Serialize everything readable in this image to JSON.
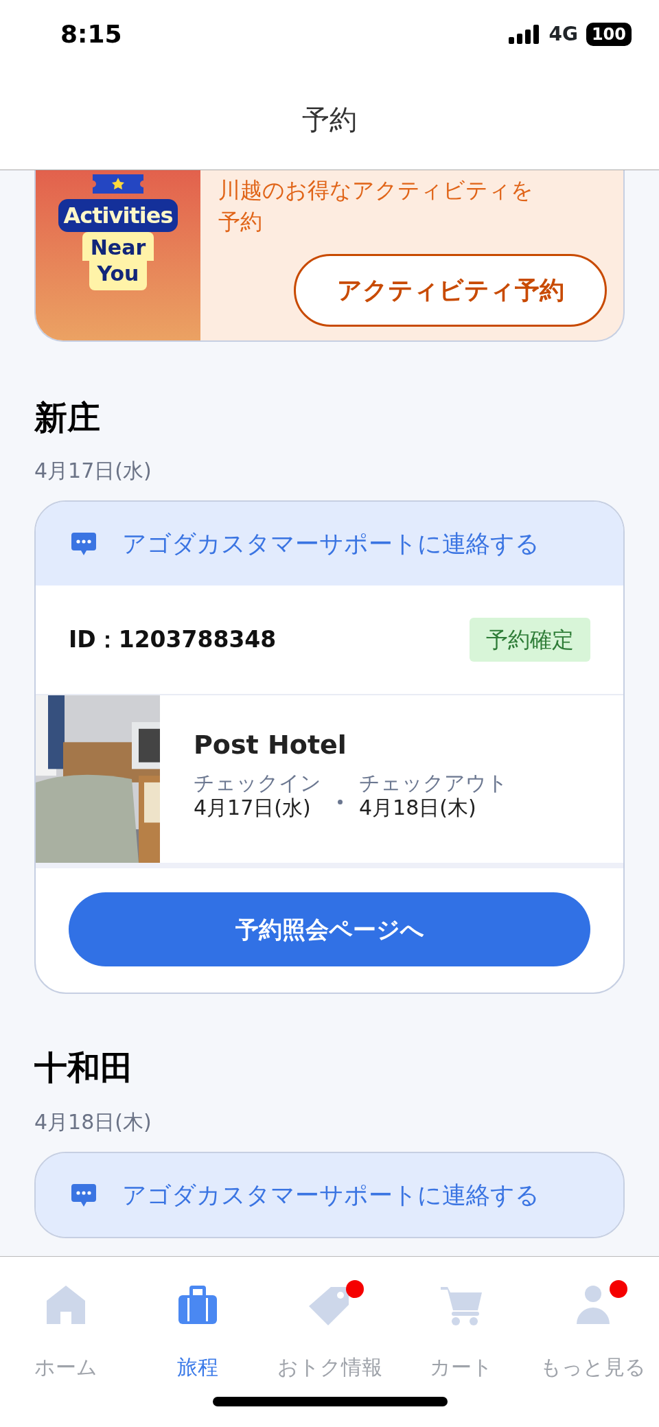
{
  "status_bar": {
    "time": "8:15",
    "network": "4G",
    "battery": "100"
  },
  "header": {
    "title": "予約"
  },
  "activity_banner": {
    "badge_lines": [
      "Activities",
      "Near",
      "You"
    ],
    "text": "川越のお得なアクティビティを予約",
    "button": "アクティビティ予約"
  },
  "trips": [
    {
      "city": "新庄",
      "date": "4月17日(水)",
      "support_link": "アゴダカスタマーサポートに連絡する",
      "booking_id": "ID：1203788348",
      "status": "予約確定",
      "hotel": {
        "name": "Post Hotel",
        "checkin_label": "チェックイン",
        "checkin": "4月17日(水)",
        "checkout_label": "チェックアウト",
        "checkout": "4月18日(木)"
      },
      "button": "予約照会ページへ"
    },
    {
      "city": "十和田",
      "date": "4月18日(木)",
      "support_link": "アゴダカスタマーサポートに連絡する"
    }
  ],
  "tab_bar": [
    {
      "label": "ホーム",
      "kind": "home",
      "selected": false,
      "badge": false
    },
    {
      "label": "旅程",
      "kind": "trips",
      "selected": true,
      "badge": false
    },
    {
      "label": "おトク情報",
      "kind": "deals",
      "selected": false,
      "badge": true
    },
    {
      "label": "カート",
      "kind": "cart",
      "selected": false,
      "badge": false
    },
    {
      "label": "もっと見る",
      "kind": "more",
      "selected": false,
      "badge": true
    }
  ]
}
